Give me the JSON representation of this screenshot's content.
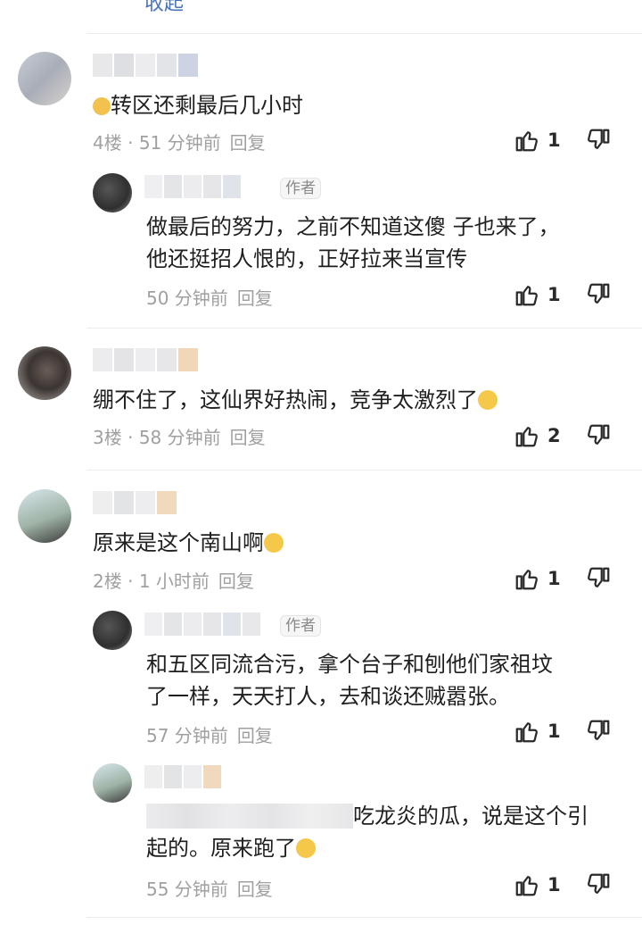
{
  "top_link": "收起",
  "comments": [
    {
      "content": "转区还剩最后几小时",
      "floor": "4楼",
      "time": "51 分钟前",
      "reply": "回复",
      "likes": "1",
      "replies": [
        {
          "content_lines": [
            "做最后的努力，之前不知道这傻 子也来了，",
            "他还挺招人恨的，正好拉来当宣传"
          ],
          "author_tag": "作者",
          "time": "50 分钟前",
          "reply": "回复",
          "likes": "1"
        }
      ]
    },
    {
      "content": "绷不住了，这仙界好热闹，竞争太激烈了",
      "floor": "3楼",
      "time": "58 分钟前",
      "reply": "回复",
      "likes": "2",
      "replies": []
    },
    {
      "content": "原来是这个南山啊",
      "floor": "2楼",
      "time": "1 小时前",
      "reply": "回复",
      "likes": "1",
      "replies": [
        {
          "content_lines": [
            "和五区同流合污，拿个台子和刨他们家祖坟",
            "了一样，天天打人，去和谈还贼嚣张。"
          ],
          "author_tag": "作者",
          "time": "57 分钟前",
          "reply": "回复",
          "likes": "1"
        },
        {
          "content_lines": [
            "吃龙炎的瓜，说是这个引",
            "起的。原来跑了"
          ],
          "time": "55 分钟前",
          "reply": "回复",
          "likes": "1"
        }
      ]
    }
  ],
  "icons": {
    "like": "thumbs-up-icon",
    "dislike": "thumbs-down-icon"
  },
  "colors": {
    "link": "#4a73b7",
    "meta": "#a0a0a0",
    "divider": "#ececec"
  }
}
